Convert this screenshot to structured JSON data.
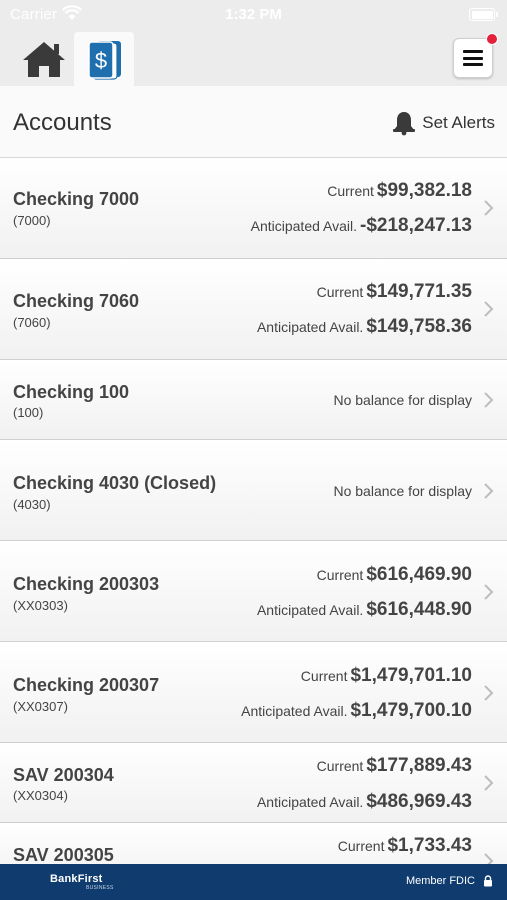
{
  "status_bar": {
    "carrier": "Carrier",
    "time": "1:32 PM"
  },
  "nav": {
    "home_icon": "home-icon",
    "accounts_icon": "dollar-cards-icon",
    "menu_icon": "hamburger-menu-icon",
    "notification_color": "#e5203a"
  },
  "header": {
    "title": "Accounts",
    "alerts_label": "Set Alerts",
    "alerts_icon": "bell-icon"
  },
  "accounts": [
    {
      "name": "Checking 7000",
      "number": "(7000)",
      "current_label": "Current",
      "current": "$99,382.18",
      "anticipated_label": "Anticipated Avail.",
      "anticipated": "-$218,247.13"
    },
    {
      "name": "Checking 7060",
      "number": "(7060)",
      "current_label": "Current",
      "current": "$149,771.35",
      "anticipated_label": "Anticipated Avail.",
      "anticipated": "$149,758.36"
    },
    {
      "name": "Checking 100",
      "number": "(100)",
      "no_balance": "No balance for display"
    },
    {
      "name": "Checking 4030 (Closed)",
      "number": "(4030)",
      "no_balance": "No balance for display"
    },
    {
      "name": "Checking 200303",
      "number": "(XX0303)",
      "current_label": "Current",
      "current": "$616,469.90",
      "anticipated_label": "Anticipated Avail.",
      "anticipated": "$616,448.90"
    },
    {
      "name": "Checking 200307",
      "number": "(XX0307)",
      "current_label": "Current",
      "current": "$1,479,701.10",
      "anticipated_label": "Anticipated Avail.",
      "anticipated": "$1,479,700.10"
    },
    {
      "name": "SAV 200304",
      "number": "(XX0304)",
      "current_label": "Current",
      "current": "$177,889.43",
      "anticipated_label": "Anticipated Avail.",
      "anticipated": "$486,969.43"
    },
    {
      "name": "SAV 200305",
      "number": "",
      "current_label": "Current",
      "current": "$1,733.43"
    }
  ],
  "footer": {
    "brand": "BankFirst",
    "brand_sub": "BUSINESS",
    "fdic": "Member FDIC",
    "lock_icon": "lock-icon",
    "background": "#0f3b6e"
  }
}
